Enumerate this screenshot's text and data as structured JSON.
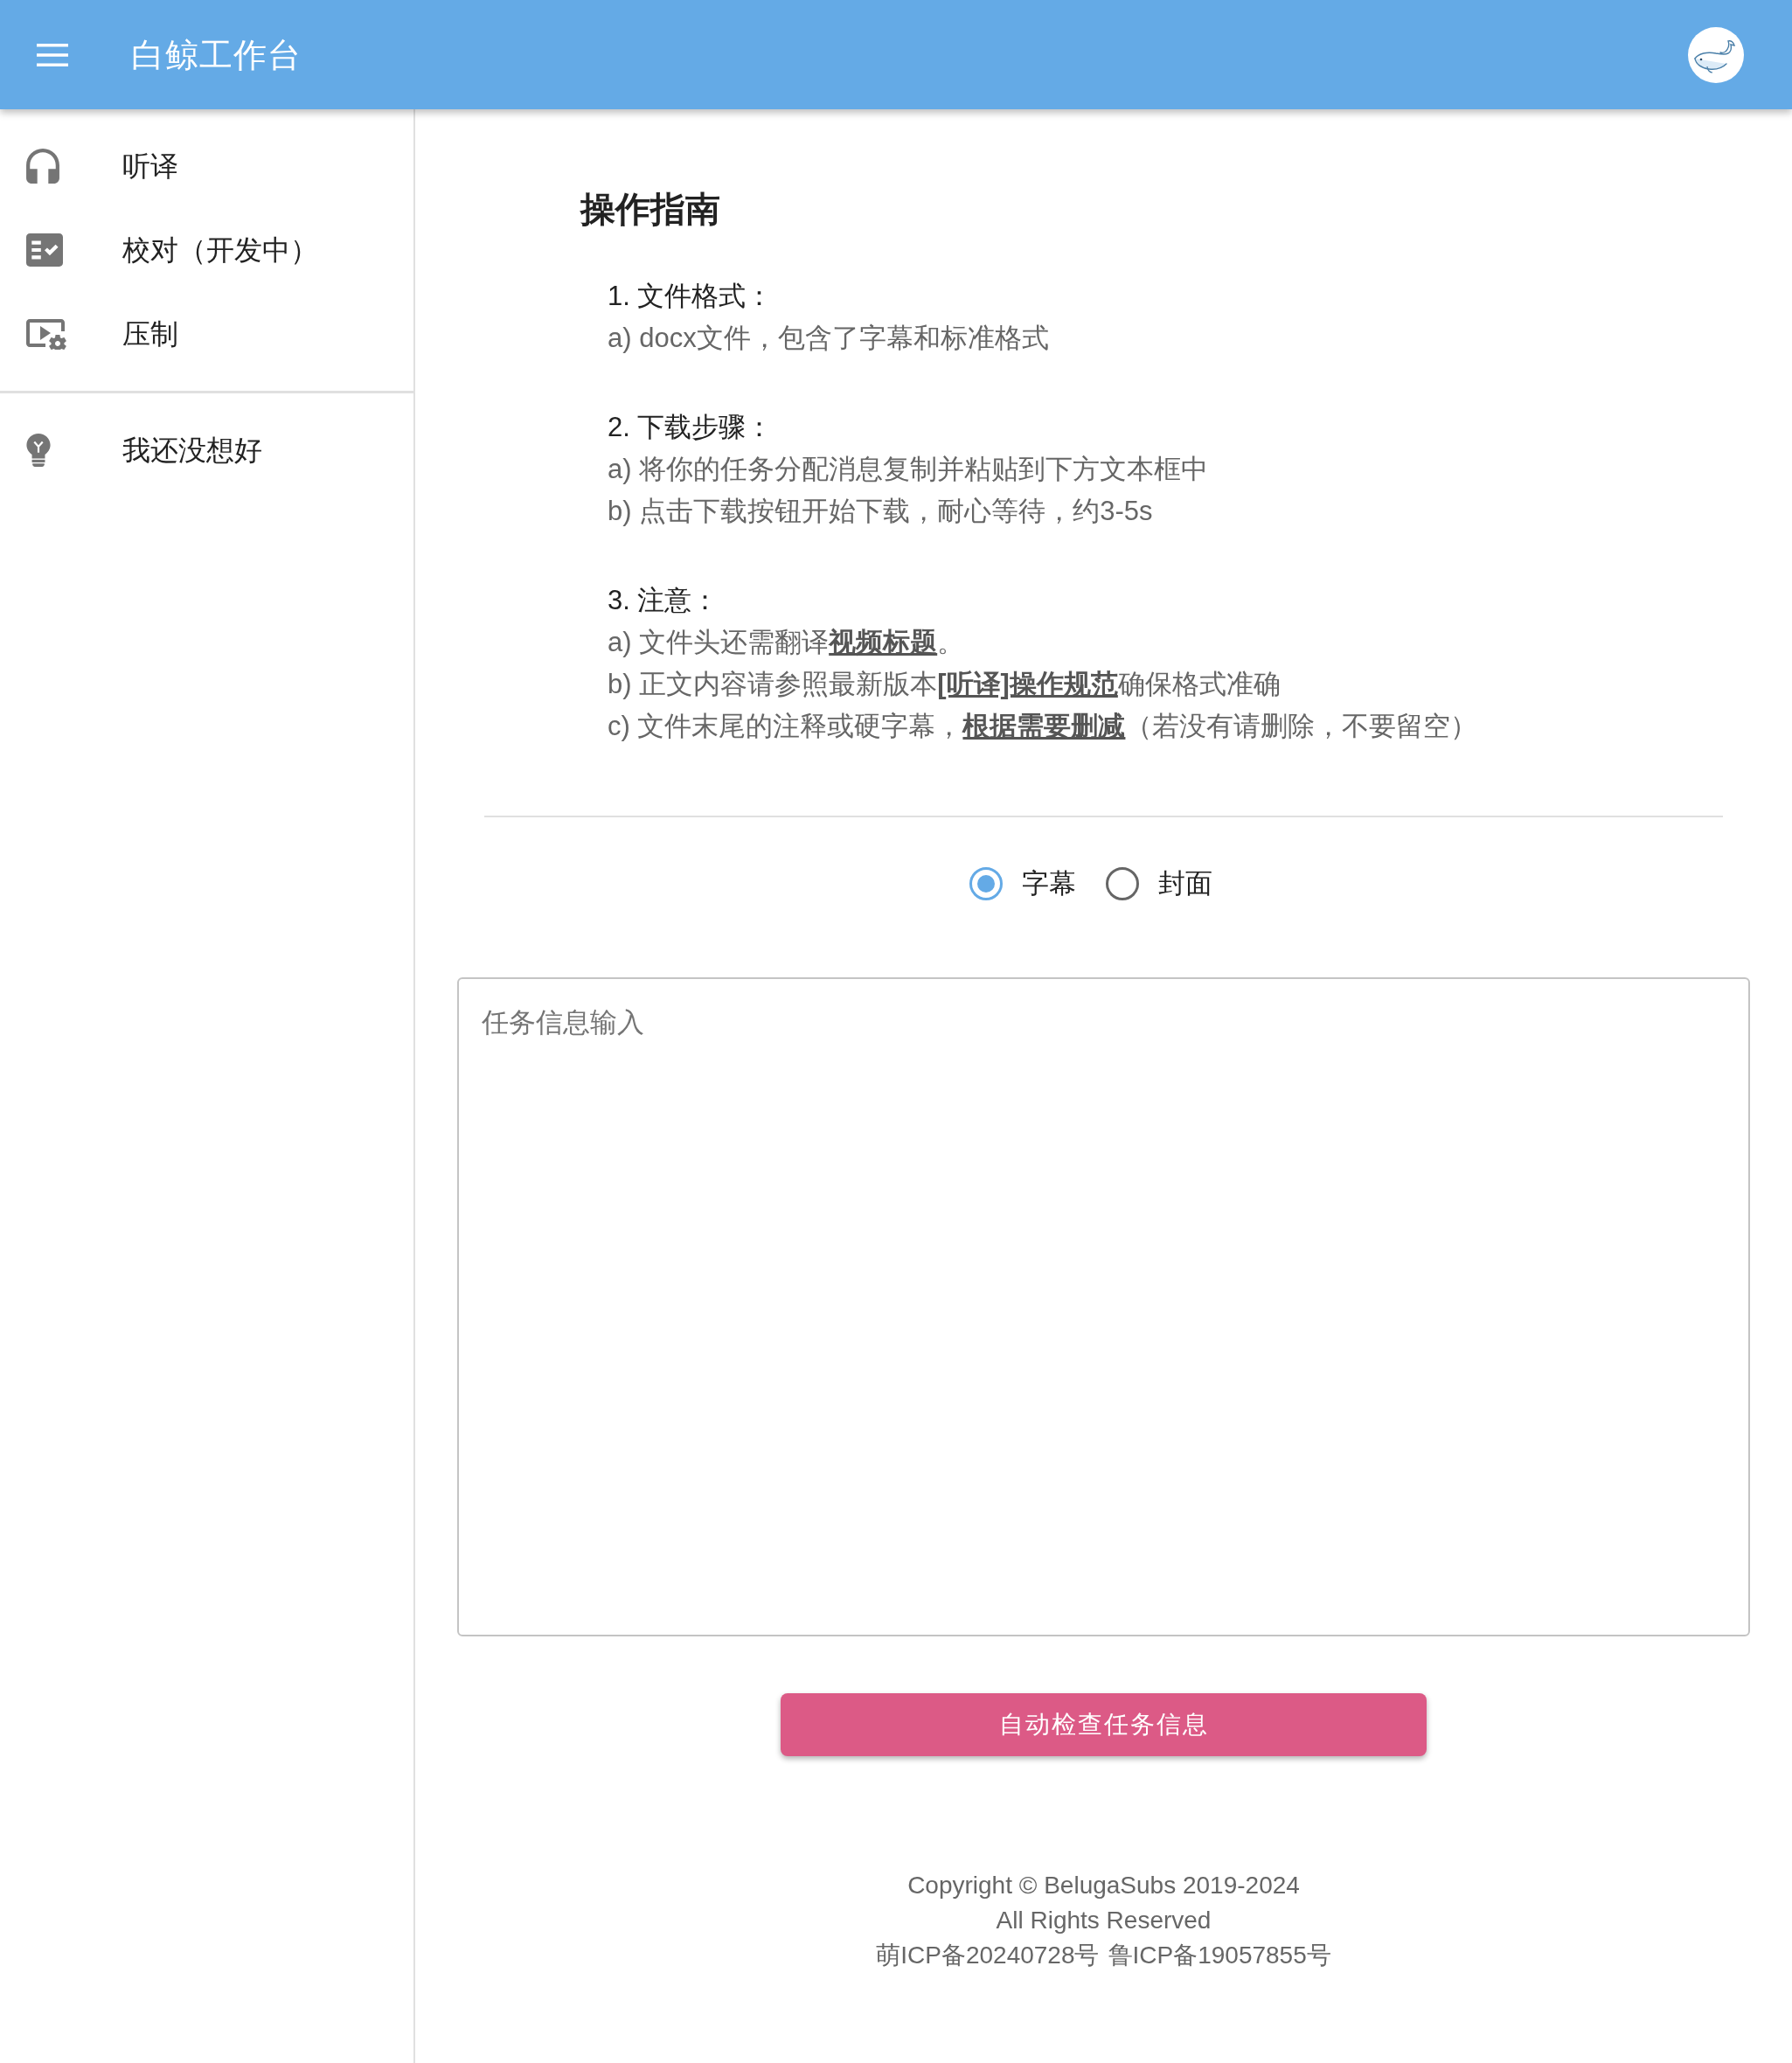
{
  "app_bar": {
    "title": "白鲸工作台"
  },
  "sidebar": {
    "sections": [
      {
        "items": [
          {
            "label": "听译",
            "selected": false
          },
          {
            "label": "校对（开发中）",
            "selected": false
          },
          {
            "label": "压制",
            "selected": false
          }
        ]
      },
      {
        "items": [
          {
            "label": "我还没想好",
            "selected": false
          }
        ]
      }
    ]
  },
  "guide": {
    "title": "操作指南",
    "sections": [
      {
        "heading": "1. 文件格式：",
        "lines": [
          {
            "segments": [
              {
                "kind": "text",
                "text": "a) docx文件，包含了字幕和标准格式"
              }
            ]
          }
        ]
      },
      {
        "heading": "2. 下载步骤：",
        "lines": [
          {
            "segments": [
              {
                "kind": "text",
                "text": "a) 将你的任务分配消息复制并粘贴到下方文本框中"
              }
            ]
          },
          {
            "segments": [
              {
                "kind": "text",
                "text": "b) 点击下载按钮开始下载，耐心等待，约3-5s"
              }
            ]
          }
        ]
      },
      {
        "heading": "3. 注意：",
        "lines": [
          {
            "segments": [
              {
                "kind": "text",
                "text": "a) 文件头还需翻译"
              },
              {
                "kind": "link",
                "text": "视频标题"
              },
              {
                "kind": "text",
                "text": "。"
              }
            ]
          },
          {
            "segments": [
              {
                "kind": "text",
                "text": "b) 正文内容请参照最新版本"
              },
              {
                "kind": "link",
                "text": "[听译]操作规范"
              },
              {
                "kind": "text",
                "text": "确保格式准确"
              }
            ]
          },
          {
            "segments": [
              {
                "kind": "text",
                "text": "c) 文件末尾的注释或硬字幕，"
              },
              {
                "kind": "link",
                "text": "根据需要删减"
              },
              {
                "kind": "text",
                "text": "（若没有请删除，不要留空）"
              }
            ]
          }
        ]
      }
    ]
  },
  "mode_options": [
    {
      "label": "字幕",
      "selected": true
    },
    {
      "label": "封面",
      "selected": false
    }
  ],
  "task_input": {
    "placeholder": "任务信息输入"
  },
  "check_button": {
    "label": "自动检查任务信息"
  },
  "footer": {
    "lines": [
      "Copyright © BelugaSubs 2019-2024",
      "All Rights Reserved"
    ],
    "registrations": [
      "萌ICP备20240728号",
      "鲁ICP备19057855号"
    ]
  }
}
